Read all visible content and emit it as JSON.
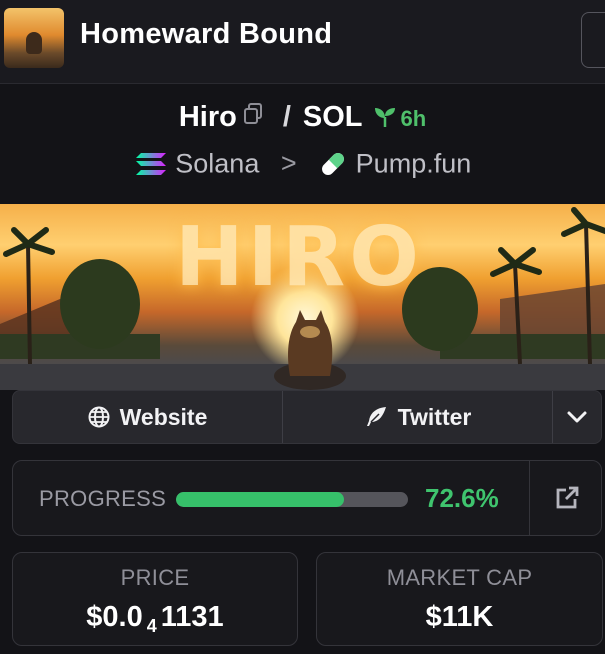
{
  "header": {
    "title": "Homeward Bound"
  },
  "pair": {
    "base": "Hiro",
    "separator": "/",
    "quote": "SOL",
    "age": "6h"
  },
  "chain": {
    "network": "Solana",
    "separator": ">",
    "dex": "Pump.fun"
  },
  "banner": {
    "word": "HIRO"
  },
  "links": {
    "website": "Website",
    "twitter": "Twitter"
  },
  "progress": {
    "label": "PROGRESS",
    "value": 0.726,
    "display": "72.6%"
  },
  "stats": {
    "price_label": "PRICE",
    "price_prefix": "$0.0",
    "price_zeros": "4",
    "price_digits": "1131",
    "mcap_label": "MARKET CAP",
    "mcap_value": "$11K"
  },
  "colors": {
    "accent_green": "#3fc46e",
    "background": "#131317",
    "panel": "#18181c"
  },
  "icons": [
    "copy-icon",
    "seedling-icon",
    "solana-icon",
    "pill-icon",
    "globe-icon",
    "feather-icon",
    "chevron-down-icon",
    "external-link-icon"
  ]
}
